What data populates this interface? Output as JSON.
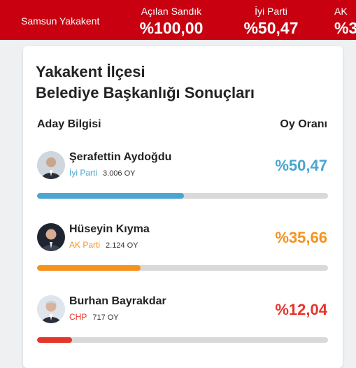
{
  "topbar": {
    "region": "Samsun Yakakent",
    "stats": [
      {
        "label": "Açılan Sandık",
        "value": "%100,00"
      },
      {
        "label": "İyi Parti",
        "value": "%50,47"
      },
      {
        "label": "AK",
        "value": "%3"
      }
    ]
  },
  "card": {
    "title_line1": "Yakakent İlçesi",
    "title_line2": "Belediye Başkanlığı Sonuçları",
    "col_left": "Aday Bilgisi",
    "col_right": "Oy Oranı"
  },
  "candidates": [
    {
      "name": "Şerafettin Aydoğdu",
      "party": "İyi Parti",
      "votes": "3.006 OY",
      "pct": "%50,47",
      "share": 0.5047,
      "color": "#4aa6d1"
    },
    {
      "name": "Hüseyin Kıyma",
      "party": "AK Parti",
      "votes": "2.124 OY",
      "pct": "%35,66",
      "share": 0.3566,
      "color": "#f7911e"
    },
    {
      "name": "Burhan Bayrakdar",
      "party": "CHP",
      "votes": "717 OY",
      "pct": "%12,04",
      "share": 0.1204,
      "color": "#e5352b"
    }
  ]
}
